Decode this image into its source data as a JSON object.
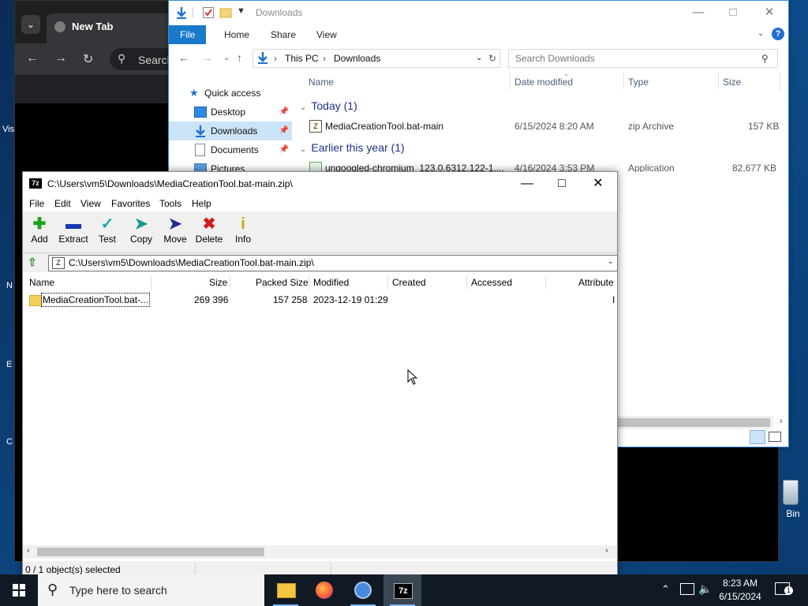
{
  "desktop": {
    "left_labels": [
      "Vis",
      "N",
      "E",
      "C"
    ],
    "recycle_bin_label": "Bin"
  },
  "chrome": {
    "tab_title": "New Tab",
    "omnibox_text": "Search"
  },
  "explorer": {
    "title": "Downloads",
    "ribbon_tabs": [
      "File",
      "Home",
      "Share",
      "View"
    ],
    "breadcrumb": [
      "This PC",
      "Downloads"
    ],
    "search_placeholder": "Search Downloads",
    "nav_items": [
      {
        "label": "Quick access",
        "icon": "star-icon"
      },
      {
        "label": "Desktop",
        "icon": "desktop-icon",
        "pinned": true
      },
      {
        "label": "Downloads",
        "icon": "download-arrow-icon",
        "pinned": true,
        "selected": true
      },
      {
        "label": "Documents",
        "icon": "document-icon",
        "pinned": true
      },
      {
        "label": "Pictures",
        "icon": "picture-icon"
      }
    ],
    "columns": [
      "Name",
      "Date modified",
      "Type",
      "Size"
    ],
    "groups": [
      {
        "label": "Today (1)",
        "files": [
          {
            "name": "MediaCreationTool.bat-main",
            "date": "6/15/2024 8:20 AM",
            "type": "zip Archive",
            "size": "157 KB"
          }
        ]
      },
      {
        "label": "Earlier this year (1)",
        "files": [
          {
            "name": "ungoogled-chromium_123.0.6312.122-1....",
            "date": "4/16/2024 3:53 PM",
            "type": "Application",
            "size": "82,677 KB"
          }
        ]
      }
    ]
  },
  "sevenzip": {
    "title": "C:\\Users\\vm5\\Downloads\\MediaCreationTool.bat-main.zip\\",
    "menu": [
      "File",
      "Edit",
      "View",
      "Favorites",
      "Tools",
      "Help"
    ],
    "toolbar": [
      {
        "label": "Add",
        "icon": "plus-icon",
        "color": "#1aa31a"
      },
      {
        "label": "Extract",
        "icon": "minus-icon",
        "color": "#1537b5"
      },
      {
        "label": "Test",
        "icon": "check-icon",
        "color": "#19a7b8"
      },
      {
        "label": "Copy",
        "icon": "copy-arrow-icon",
        "color": "#1a9a8a"
      },
      {
        "label": "Move",
        "icon": "move-arrow-icon",
        "color": "#1b2f8f"
      },
      {
        "label": "Delete",
        "icon": "x-icon",
        "color": "#d11c1c"
      },
      {
        "label": "Info",
        "icon": "info-icon",
        "color": "#c7a600"
      }
    ],
    "path": "C:\\Users\\vm5\\Downloads\\MediaCreationTool.bat-main.zip\\",
    "columns": [
      "Name",
      "Size",
      "Packed Size",
      "Modified",
      "Created",
      "Accessed",
      "Attribute"
    ],
    "rows": [
      {
        "name": "MediaCreationTool.bat-...",
        "size": "269 396",
        "packed": "157 258",
        "modified": "2023-12-19 01:29",
        "created": "",
        "accessed": "",
        "attr": "I"
      }
    ],
    "status": "0 / 1 object(s) selected"
  },
  "taskbar": {
    "search_placeholder": "Type here to search",
    "time": "8:23 AM",
    "date": "6/15/2024",
    "notification_count": "1"
  }
}
